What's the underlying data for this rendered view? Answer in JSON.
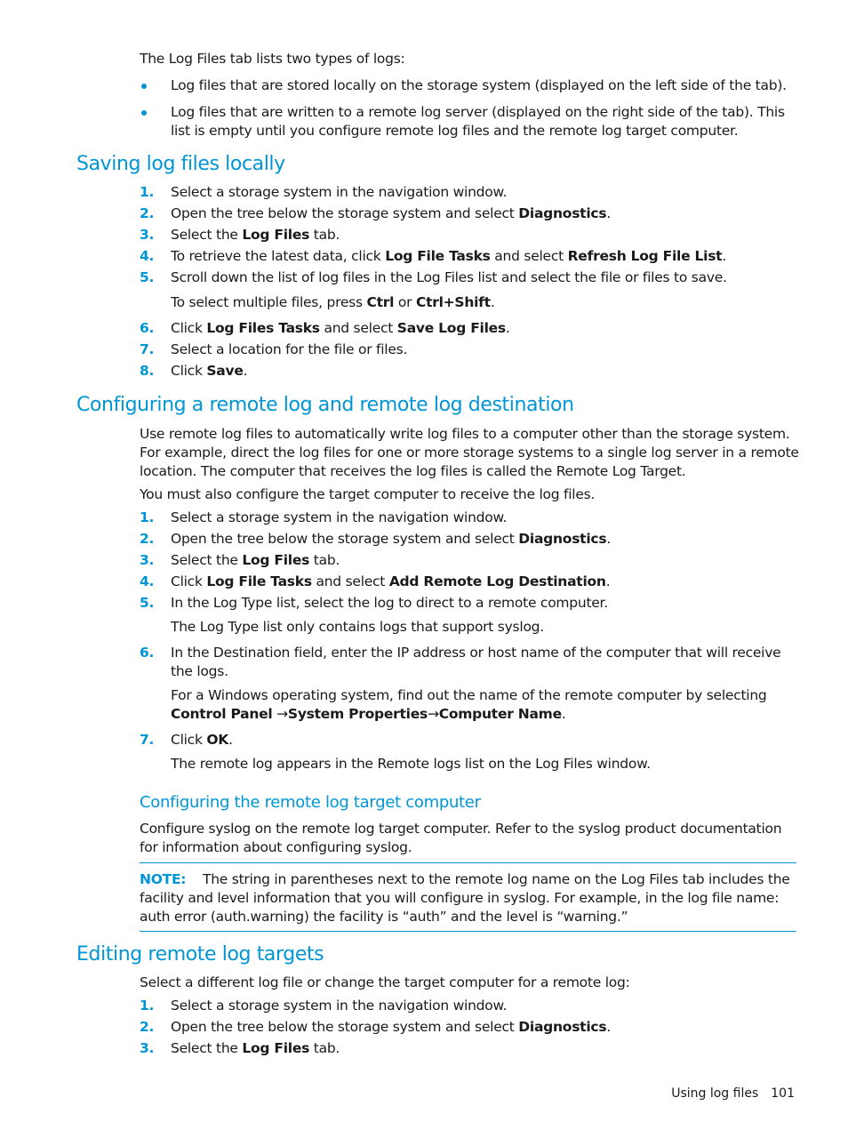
{
  "intro": {
    "text": "The Log Files tab lists two types of logs:",
    "bullets": [
      "Log files that are stored locally on the storage system (displayed on the left side of the tab).",
      "Log files that are written to a remote log server (displayed on the right side of the tab). This list is empty until you configure remote log files and the remote log target computer."
    ]
  },
  "colors": {
    "accent": "#0096d6",
    "text": "#1a1a1a"
  },
  "section_saving": {
    "heading": "Saving log files locally",
    "steps": [
      {
        "num": "1.",
        "parts": [
          "Select a storage system in the navigation window."
        ]
      },
      {
        "num": "2.",
        "pre": "Open the tree below the storage system and select ",
        "b1": "Diagnostics",
        "post": "."
      },
      {
        "num": "3.",
        "pre": "Select the ",
        "b1": "Log Files",
        "post": " tab."
      },
      {
        "num": "4.",
        "pre": "To retrieve the latest data, click ",
        "b1": "Log File Tasks",
        "mid": " and select ",
        "b2": "Refresh Log File List",
        "post": "."
      },
      {
        "num": "5.",
        "parts": [
          "Scroll down the list of log files in the Log Files list and select the file or files to save."
        ],
        "sub_pre": "To select multiple files, press ",
        "sub_b1": "Ctrl",
        "sub_mid": " or ",
        "sub_b2": "Ctrl+Shift",
        "sub_post": "."
      },
      {
        "num": "6.",
        "pre": "Click ",
        "b1": "Log Files Tasks",
        "mid": " and select ",
        "b2": "Save Log Files",
        "post": "."
      },
      {
        "num": "7.",
        "parts": [
          "Select a location for the file or files."
        ]
      },
      {
        "num": "8.",
        "pre": "Click ",
        "b1": "Save",
        "post": "."
      }
    ]
  },
  "section_remote": {
    "heading": "Configuring a remote log and remote log destination",
    "para1": "Use remote log files to automatically write log files to a computer other than the storage system. For example, direct the log files for one or more storage systems to a single log server in a remote location. The computer that receives the log files is called the Remote Log Target.",
    "para2": "You must also configure the target computer to receive the log files.",
    "steps": [
      {
        "num": "1.",
        "parts": [
          "Select a storage system in the navigation window."
        ]
      },
      {
        "num": "2.",
        "pre": "Open the tree below the storage system and select ",
        "b1": "Diagnostics",
        "post": "."
      },
      {
        "num": "3.",
        "pre": "Select the ",
        "b1": "Log Files",
        "post": " tab."
      },
      {
        "num": "4.",
        "pre": "Click ",
        "b1": "Log File Tasks",
        "mid": " and select ",
        "b2": "Add Remote Log Destination",
        "post": "."
      },
      {
        "num": "5.",
        "parts": [
          "In the Log Type list, select the log to direct to a remote computer."
        ],
        "sub": "The Log Type list only contains logs that support syslog."
      },
      {
        "num": "6.",
        "parts": [
          "In the Destination field, enter the IP address or host name of the computer that will receive the logs."
        ],
        "sub_pre": "For a Windows operating system, find out the name of the remote computer by selecting ",
        "sub_b1": "Control Panel",
        "sub_arrow1": " →",
        "sub_b2": "System Properties",
        "sub_arrow2": "→",
        "sub_b3": "Computer Name",
        "sub_post": "."
      },
      {
        "num": "7.",
        "pre": "Click ",
        "b1": "OK",
        "post": ".",
        "sub": "The remote log appears in the Remote logs list on the Log Files window."
      }
    ],
    "subsection": {
      "heading": "Configuring the remote log target computer",
      "para": "Configure syslog on the remote log target computer. Refer to the syslog product documentation for information about configuring syslog.",
      "note_label": "NOTE:",
      "note_text": "The string in parentheses next to the remote log name on the Log Files tab includes the facility and level information that you will configure in syslog. For example, in the log file name: auth error (auth.warning) the facility is “auth” and the level is “warning.”"
    }
  },
  "section_editing": {
    "heading": "Editing remote log targets",
    "para": "Select a different log file or change the target computer for a remote log:",
    "steps": [
      {
        "num": "1.",
        "parts": [
          "Select a storage system in the navigation window."
        ]
      },
      {
        "num": "2.",
        "pre": "Open the tree below the storage system and select ",
        "b1": "Diagnostics",
        "post": "."
      },
      {
        "num": "3.",
        "pre": "Select the ",
        "b1": "Log Files",
        "post": " tab."
      }
    ]
  },
  "footer": {
    "section": "Using log files",
    "page": "101"
  }
}
